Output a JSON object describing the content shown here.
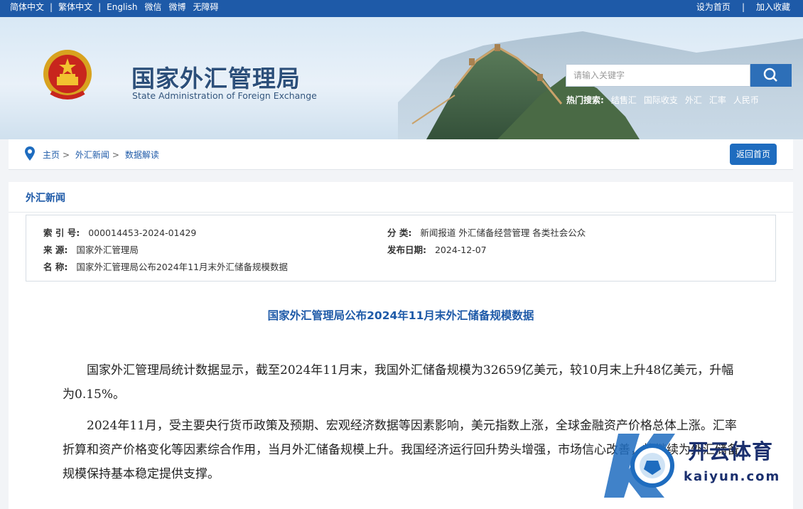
{
  "topbar": {
    "left_links": [
      "简体中文",
      "繁体中文",
      "English",
      "微信",
      "微博",
      "无障碍"
    ],
    "right_links": [
      "设为首页",
      "加入收藏"
    ]
  },
  "header": {
    "site_name_cn": "国家外汇管理局",
    "site_name_en": "State Administration of Foreign Exchange",
    "search_placeholder": "请输入关键字",
    "hot_label": "热门搜索:",
    "hot_terms": [
      "结售汇",
      "国际收支",
      "外汇",
      "汇率",
      "人民币"
    ]
  },
  "breadcrumb": {
    "items": [
      "主页",
      "外汇新闻",
      "数据解读"
    ],
    "back_label": "返回首页"
  },
  "section": {
    "title": "外汇新闻"
  },
  "meta": {
    "index_label": "索 引 号:",
    "index_value": "000014453-2024-01429",
    "category_label": "分      类:",
    "category_value": "新闻报道  外汇储备经营管理  各类社会公众",
    "source_label": "来      源:",
    "source_value": "国家外汇管理局",
    "date_label": "发布日期:",
    "date_value": "2024-12-07",
    "name_label": "名      称:",
    "name_value": "国家外汇管理局公布2024年11月末外汇储备规模数据"
  },
  "article": {
    "title": "国家外汇管理局公布2024年11月末外汇储备规模数据",
    "p1": "国家外汇管理局统计数据显示，截至2024年11月末，我国外汇储备规模为32659亿美元，较10月末上升48亿美元，升幅为0.15%。",
    "p2": "2024年11月，受主要央行货币政策及预期、宏观经济数据等因素影响，美元指数上涨，全球金融资产价格总体上涨。汇率折算和资产价格变化等因素综合作用，当月外汇储备规模上升。我国经济运行回升势头增强，市场信心改善，将继续为外汇储备规模保持基本稳定提供支撑。"
  },
  "watermark": {
    "brand_cn": "开云体育",
    "brand_en": "kaiyun.com"
  },
  "colors": {
    "topbar": "#1e5aa8",
    "link": "#1e5aa8",
    "button": "#1e6cbf"
  }
}
